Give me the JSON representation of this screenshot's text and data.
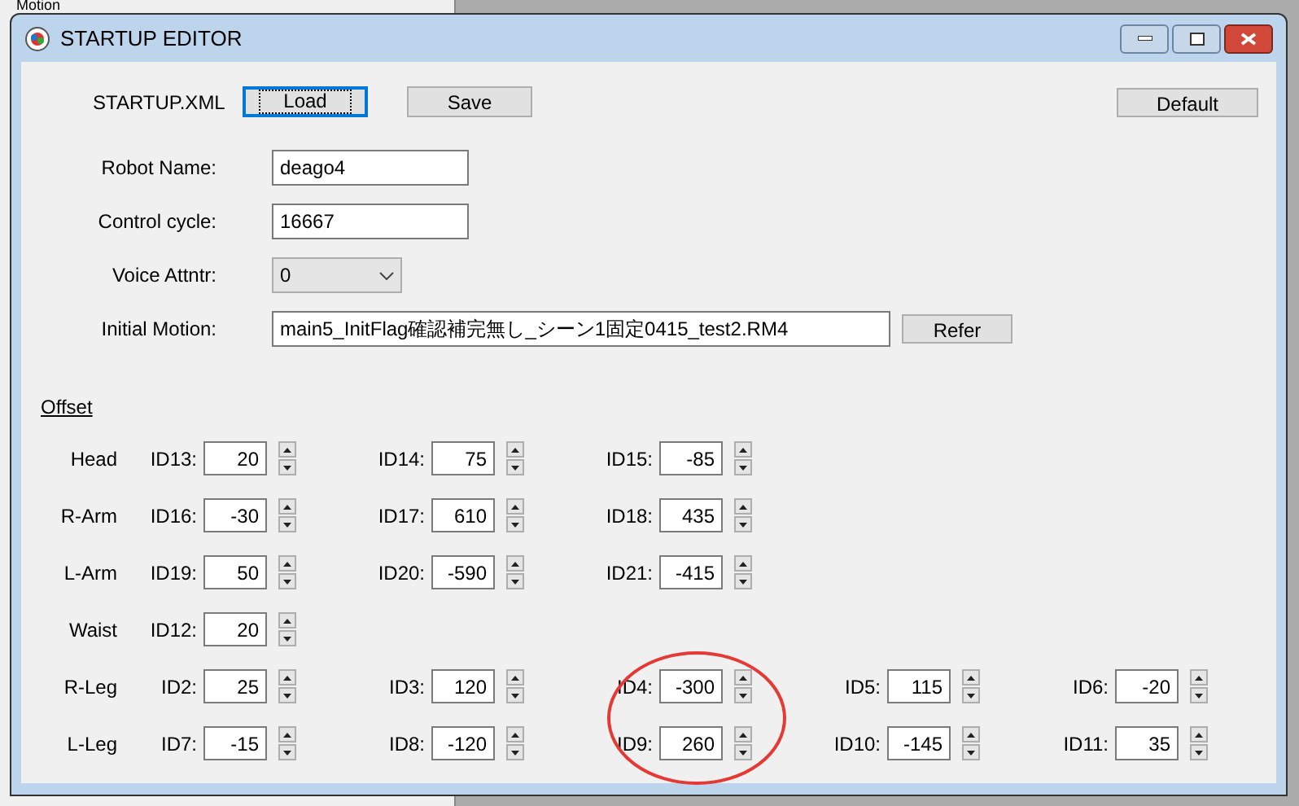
{
  "background_window": {
    "title_fragment": "Motion"
  },
  "window": {
    "title": "STARTUP EDITOR"
  },
  "file_bar": {
    "label": "STARTUP.XML",
    "buttons": [
      {
        "label": "Load",
        "focused": true
      },
      {
        "label": "Save",
        "focused": false
      }
    ],
    "default_button": "Default"
  },
  "settings": [
    {
      "kind": "text",
      "label": "Robot Name:",
      "value": "deago4"
    },
    {
      "kind": "text",
      "label": "Control cycle:",
      "value": "16667"
    },
    {
      "kind": "combo",
      "label": "Voice Attntr:",
      "value": "0"
    },
    {
      "kind": "file",
      "label": "Initial Motion:",
      "value": "main5_InitFlag確認補完無し_シーン1固定0415_test2.RM4",
      "button": "Refer"
    }
  ],
  "offset": {
    "title": "Offset",
    "rows": [
      {
        "part": "Head",
        "fields": [
          {
            "id": "ID13:",
            "value": "20"
          },
          {
            "id": "ID14:",
            "value": "75"
          },
          {
            "id": "ID15:",
            "value": "-85"
          }
        ]
      },
      {
        "part": "R-Arm",
        "fields": [
          {
            "id": "ID16:",
            "value": "-30"
          },
          {
            "id": "ID17:",
            "value": "610"
          },
          {
            "id": "ID18:",
            "value": "435"
          }
        ]
      },
      {
        "part": "L-Arm",
        "fields": [
          {
            "id": "ID19:",
            "value": "50"
          },
          {
            "id": "ID20:",
            "value": "-590"
          },
          {
            "id": "ID21:",
            "value": "-415"
          }
        ]
      },
      {
        "part": "Waist",
        "fields": [
          {
            "id": "ID12:",
            "value": "20"
          }
        ]
      },
      {
        "part": "R-Leg",
        "fields": [
          {
            "id": "ID2:",
            "value": "25"
          },
          {
            "id": "ID3:",
            "value": "120"
          },
          {
            "id": "ID4:",
            "value": "-300"
          },
          {
            "id": "ID5:",
            "value": "115"
          },
          {
            "id": "ID6:",
            "value": "-20"
          }
        ]
      },
      {
        "part": "L-Leg",
        "fields": [
          {
            "id": "ID7:",
            "value": "-15"
          },
          {
            "id": "ID8:",
            "value": "-120"
          },
          {
            "id": "ID9:",
            "value": "260"
          },
          {
            "id": "ID10:",
            "value": "-145"
          },
          {
            "id": "ID11:",
            "value": "35"
          }
        ]
      }
    ]
  }
}
